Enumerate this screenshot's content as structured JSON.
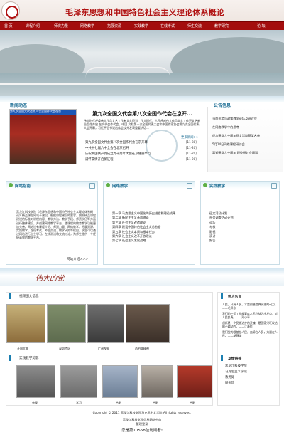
{
  "header": {
    "title": "毛泽东思想和中国特色社会主义理论体系概论"
  },
  "nav": [
    "首 页",
    "课程介绍",
    "师资力量",
    "网络教学",
    "拓展资源",
    "实践教学",
    "在线考试",
    "师生交流",
    "教学研究",
    "论 坛"
  ],
  "news": {
    "section_title": "新闻动态",
    "image_caption": "第九次全国文代会第八次全国作代会在京...",
    "headline": "第九次全国文代会第八次全国作代会在京开...",
    "summary": "伟大时代呼唤伟大作品文艺工作者文艺担当　作大时代，人民呼唤伟大作品文艺工作不文艺新业百花齐放 在文代会作代会，中国 文联第十次全国代表大会和中国作家协会第九次全国代表 大会开幕，习近平总书记出席会议并发表重要讲话...",
    "more": "更多新闻>>",
    "links": [
      "第九次全国文代会第八次全国作代会在京开幕",
      "中共十七届六中全会在北京召开",
      "庆祝中国共产党成立九十周年大会在京隆重举行",
      "满怀豪情开启新征程"
    ],
    "dates": [
      "[11-30]",
      "[11-20]",
      "[11-20]",
      "[11-20]"
    ]
  },
  "notice": {
    "section_title": "公告信息",
    "items": [
      "当前形势与政策教学论坛及研讨会",
      "在网络教学中的思考",
      "纪念建党九十周年征文活动获奖名单",
      "5月14日网络课程研讨会",
      "喜迎建党九十周年 理论研讨会通知"
    ]
  },
  "guide": {
    "title": "网站指南",
    "text": "黑龙江科技学院《毛泽东思想和中国特色社会主义理论体系概论》精品课程网站于建设，根据课程建设的要求，按照精品课程建设的标准对课程内容、教学方法、教学手段、师资队伍等方面进行整体建设，并创建网络教学平台，使课程的教育教学功能更加完善。网站设有课程介绍、师资力量、网络教学、拓展资源、实践教学、在线考试、师生交流、教学研究等栏目，学生可以通过网站进行自主学习、在线测试和交流讨论，为师生提供一个便捷高效的教学平台。",
    "more": "网站介绍>>>"
  },
  "teaching": {
    "title": "网络教学",
    "items": [
      "第一章 马克思主义中国化的历史进程和理论成果",
      "第二章 新民主主义革命理论",
      "第三章 社会主义改造理论",
      "第四章 建设中国特色社会主义总依据",
      "第五章 社会主义本质和根本任务",
      "第六章 社会主义改革开放理论",
      "第七章 社会主义发展战略"
    ]
  },
  "practice": {
    "title": "实践教学",
    "items": [
      "征文活动计划",
      "社会调查活动计划",
      "论坛",
      "考核",
      "影视",
      "演讲",
      "报告"
    ]
  },
  "slogan": "伟大的党",
  "media": {
    "video_title": "视频图文信息",
    "photos": [
      "开国大典",
      "深圳特区",
      "广州视察",
      "西柏坡精神"
    ],
    "gallery_title": "实践教学剪影",
    "gallery": [
      "参观",
      "学习",
      "合影",
      "合影",
      "合影"
    ]
  },
  "people": {
    "title": "伟人名言",
    "quotes": [
      "人民，只有人民，才是创造世界历史的动力。——毛泽东",
      "我们的一切工作都要以人民利益为出发点，对人民负责。——邓小平",
      "创新是一个民族进步的灵魂，是国家兴旺发达的不竭动力。——江泽民",
      "我们党的根基在人民，血脉在人民，力量在人民。——胡锦涛"
    ]
  },
  "links": {
    "title": "友情链接",
    "items": [
      "黑龙江科技学院",
      "马克思主义学院",
      "教务处",
      "图书馆"
    ]
  },
  "footer": {
    "copyright": "Copyright © 2011 黑龙江科技学院马克思主义学院 All rights reserved.",
    "unit": "黑龙江科技学院信息网络中心",
    "admin": "管理登录",
    "visitor": "您是第10558位访问者!"
  }
}
